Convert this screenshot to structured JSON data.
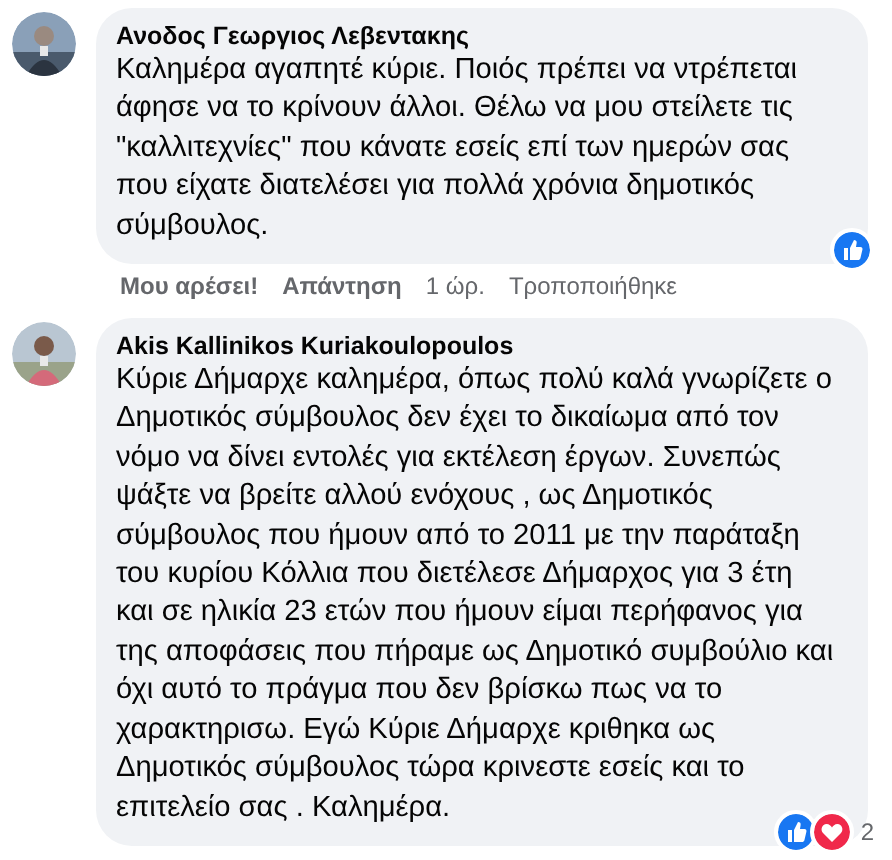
{
  "comments": [
    {
      "author": "Ανοδος Γεωργιος Λεβεντακης",
      "text": "Καλημέρα αγαπητέ κύριε. Ποιός πρέπει να ντρέπεται άφησε να το κρίνουν άλλοι. Θέλω να μου στείλετε τις \"καλλιτεχνίες\" που κάνατε εσείς επί των ημερών σας που είχατε διατελέσει για πολλά χρόνια δημοτικός σύμβουλος.",
      "reactions": [
        {
          "kind": "like"
        }
      ],
      "actions": [
        {
          "kind": "link",
          "label": "Μου αρέσει!"
        },
        {
          "kind": "link",
          "label": "Απάντηση"
        },
        {
          "kind": "meta",
          "label": "1 ώρ."
        },
        {
          "kind": "meta",
          "label": "Τροποποιήθηκε"
        }
      ]
    },
    {
      "author": "Akis Kallinikos Kuriakoulopoulos",
      "text": "Κύριε Δήμαρχε καλημέρα, όπως πολύ καλά γνωρίζετε ο Δημοτικός σύμβουλος δεν έχει το δικαίωμα από τον νόμο να δίνει εντολές για εκτέλεση έργων. Συνεπώς ψάξτε να βρείτε αλλού ενόχους , ως Δημοτικός σύμβουλος που ήμουν από το 2011 με την παράταξη του κυρίου Κόλλια που διετέλεσε Δήμαρχος για 3 έτη και σε ηλικία 23 ετών που ήμουν είμαι περήφανος για της αποφάσεις που πήραμε ως Δημοτικό συμβούλιο και όχι αυτό το πράγμα που δεν βρίσκω πως να το χαρακτηρισω. Εγώ Κύριε Δήμαρχε κριθηκα ως Δημοτικός σύμβουλος τώρα κρινεστε εσείς και το επιτελείο σας . Καλημέρα.",
      "reactions": [
        {
          "kind": "like"
        },
        {
          "kind": "love"
        }
      ],
      "reaction_count": "2"
    }
  ]
}
